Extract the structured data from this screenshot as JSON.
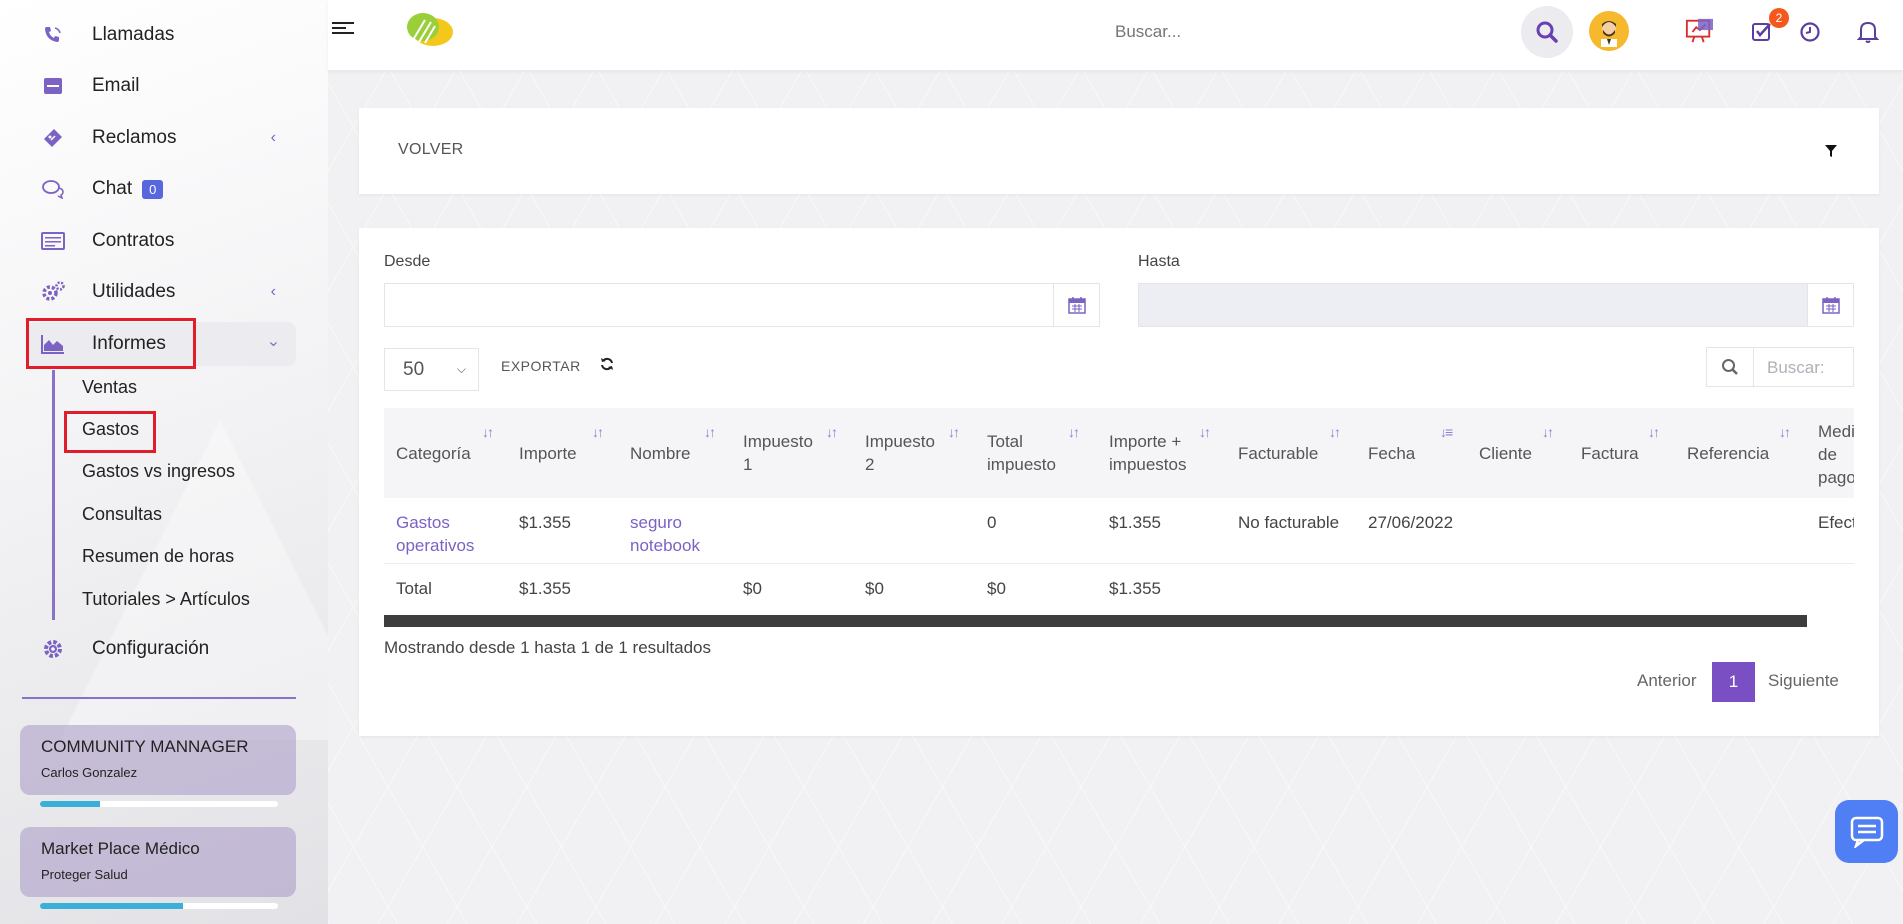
{
  "sidebar": {
    "items": [
      {
        "label": "Llamadas",
        "icon": "phone-icon"
      },
      {
        "label": "Email",
        "icon": "email-icon"
      },
      {
        "label": "Reclamos",
        "icon": "ticket-icon"
      },
      {
        "label": "Chat",
        "icon": "chat-icon",
        "badge": "0"
      },
      {
        "label": "Contratos",
        "icon": "contracts-icon"
      },
      {
        "label": "Utilidades",
        "icon": "gears-icon"
      },
      {
        "label": "Informes",
        "icon": "area-chart-icon"
      },
      {
        "label": "Configuración",
        "icon": "gear-icon"
      }
    ],
    "subitems": [
      "Ventas",
      "Gastos",
      "Gastos vs ingresos",
      "Consultas",
      "Resumen de horas",
      "Tutoriales > Artículos"
    ],
    "cards": [
      {
        "title": "COMMUNITY MANNAGER",
        "subtitle": "Carlos Gonzalez",
        "progress": 0.25
      },
      {
        "title": "Market Place Médico",
        "subtitle": "Proteger Salud",
        "progress": 0.6
      }
    ]
  },
  "topbar": {
    "search_placeholder": "Buscar...",
    "tasks_badge": "2"
  },
  "filter_panel": {
    "back_label": "VOLVER"
  },
  "form": {
    "from_label": "Desde",
    "to_label": "Hasta"
  },
  "table_controls": {
    "page_size": "50",
    "export_label": "EXPORTAR",
    "search_placeholder": "Buscar:"
  },
  "table": {
    "headers": [
      "Categoría",
      "Importe",
      "Nombre",
      "Impuesto 1",
      "Impuesto 2",
      "Total impuesto",
      "Importe + impuestos",
      "Facturable",
      "Fecha",
      "Cliente",
      "Factura",
      "Referencia",
      "Medio de pago"
    ],
    "rows": [
      {
        "categoria": "Gastos operativos",
        "importe": "$1.355",
        "nombre": "seguro notebook",
        "impuesto1": "",
        "impuesto2": "",
        "total_impuesto": "0",
        "importe_impuestos": "$1.355",
        "facturable": "No facturable",
        "fecha": "27/06/2022",
        "cliente": "",
        "factura": "",
        "referencia": "",
        "medio": "Efect"
      }
    ],
    "totals": {
      "label": "Total",
      "importe": "$1.355",
      "impuesto1": "$0",
      "impuesto2": "$0",
      "total_impuesto": "$0",
      "importe_impuestos": "$1.355"
    }
  },
  "info": "Mostrando desde 1 hasta 1 de 1 resultados",
  "pagination": {
    "prev": "Anterior",
    "current": "1",
    "next": "Siguiente"
  },
  "colors": {
    "accent": "#7b62c3",
    "highlight": "#e11d2a",
    "page_active": "#7b4fc4"
  }
}
